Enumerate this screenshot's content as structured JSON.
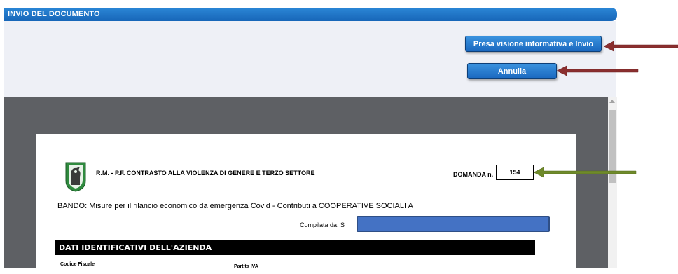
{
  "dialog": {
    "title": "INVIO DEL DOCUMENTO",
    "buttons": {
      "send_label": "Presa visione informativa e Invio",
      "cancel_label": "Annulla"
    }
  },
  "document": {
    "organization": "R.M. - P.F. CONTRASTO ALLA VIOLENZA DI GENERE E TERZO SETTORE",
    "domanda_label": "DOMANDA n.",
    "domanda_number": "154",
    "bando": "BANDO: Misure per il rilancio economico da emergenza Covid - Contributi a COOPERATIVE SOCIALI  A",
    "compilata_label": "Compilata da: S",
    "section_title": "DATI IDENTIFICATIVI DELL'AZIENDA",
    "fields": {
      "codice_fiscale": "Codice Fiscale",
      "partita_iva": "Partita IVA"
    }
  },
  "colors": {
    "titlebar": "#1f74c9",
    "button": "#2a7fd3",
    "arrow_red": "#8b2f2f",
    "arrow_green": "#6f8a2a",
    "redaction": "#4472c4"
  }
}
